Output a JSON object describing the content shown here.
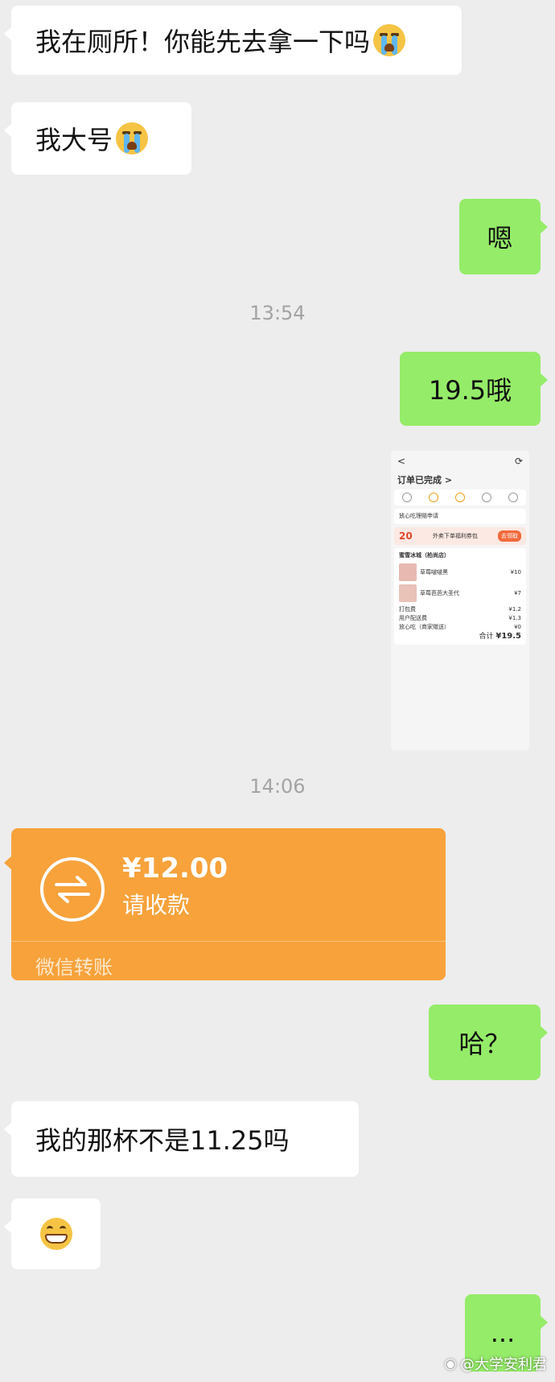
{
  "messages": {
    "m1": "我在厕所！你能先去拿一下吗",
    "m2": "我大号",
    "m3": "嗯",
    "m4": "19.5哦",
    "m5": "哈？",
    "m6": "我的那杯不是11.25吗",
    "m7": "..."
  },
  "timestamps": {
    "t1": "13:54",
    "t2": "14:06"
  },
  "screenshot": {
    "back": "<",
    "title": "订单已完成 >",
    "notice": "放心吃理赔申请",
    "promo_amount": "20",
    "promo_text": "外卖下单福利券包",
    "promo_button": "去领取",
    "shop": "蜜雪冰城（柏尚店）",
    "item1": "草莓啵啵黑",
    "item1_price": "¥10",
    "item2": "草莓芭芭大圣代",
    "item2_price": "¥7",
    "fee1_label": "打包费",
    "fee1_value": "¥1.2",
    "fee2_label": "用户配送费",
    "fee2_value": "¥1.3",
    "fee3_label": "放心吃（商家赠送）",
    "fee3_value": "¥0",
    "total_label": "合计",
    "total_value": "¥19.5"
  },
  "transfer": {
    "amount": "¥12.00",
    "note": "请收款",
    "footer": "微信转账",
    "icon": "transfer-arrows-icon"
  },
  "emojis": [
    "crying-face-icon",
    "crying-face-icon",
    "grinning-face-icon"
  ],
  "watermark": "@大学安利君",
  "colors": {
    "background": "#ededed",
    "sent_bubble": "#95ec69",
    "received_bubble": "#ffffff",
    "transfer": "#f7a23b"
  }
}
